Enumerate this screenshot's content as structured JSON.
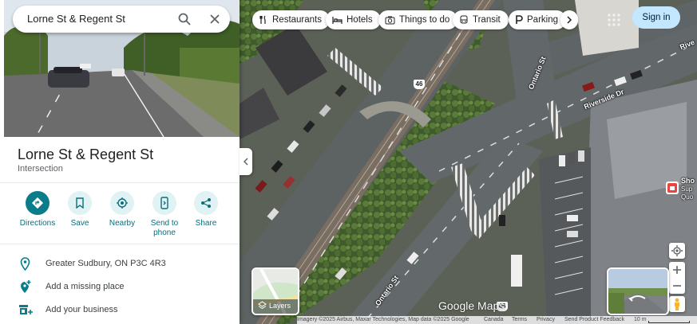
{
  "search": {
    "query": "Lorne St & Regent St"
  },
  "place": {
    "title": "Lorne St & Regent St",
    "subtitle": "Intersection"
  },
  "actions": [
    {
      "label": "Directions",
      "icon": "directions-icon"
    },
    {
      "label": "Save",
      "icon": "bookmark-icon"
    },
    {
      "label": "Nearby",
      "icon": "nearby-icon"
    },
    {
      "label": "Send to phone",
      "icon": "phone-icon"
    },
    {
      "label": "Share",
      "icon": "share-icon"
    }
  ],
  "info": [
    {
      "text": "Greater Sudbury, ON P3C 4R3",
      "icon": "location-pin-icon"
    },
    {
      "text": "Add a missing place",
      "icon": "add-place-icon"
    },
    {
      "text": "Add your business",
      "icon": "add-business-icon"
    }
  ],
  "chips": [
    {
      "label": "Restaurants",
      "icon": "fork-knife-icon"
    },
    {
      "label": "Hotels",
      "icon": "bed-icon"
    },
    {
      "label": "Things to do",
      "icon": "camera-icon"
    },
    {
      "label": "Transit",
      "icon": "bus-icon"
    },
    {
      "label": "Parking",
      "icon": "parking-icon"
    }
  ],
  "header": {
    "signin": "Sign in"
  },
  "map": {
    "labels": {
      "ontario_upper": "Ontario St",
      "riverside": "Riverside Dr",
      "river": "Rive",
      "ontario_lower": "Ontario St",
      "shop": "Sho",
      "shop2": "Sup",
      "shop3": "Quo"
    },
    "shield1": "46",
    "shield2": "46",
    "layers_label": "Layers",
    "logo": "Google Maps",
    "attribution": {
      "imagery": "Imagery ©2025 Airbus, Maxar Technologies, Map data ©2025 Google",
      "canada": "Canada",
      "terms": "Terms",
      "privacy": "Privacy",
      "feedback": "Send Product Feedback",
      "scale": "10 m"
    }
  },
  "colors": {
    "accent": "#0b7c8a",
    "signin_bg": "#c2e7ff"
  }
}
